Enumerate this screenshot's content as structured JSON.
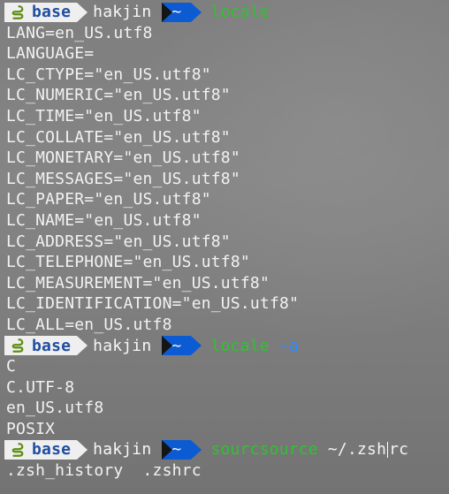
{
  "prompt": {
    "env": "base",
    "user": "hakjin",
    "dir": "~"
  },
  "commands": [
    {
      "command": "locale",
      "arg": "",
      "output": [
        "LANG=en_US.utf8",
        "LANGUAGE=",
        "LC_CTYPE=\"en_US.utf8\"",
        "LC_NUMERIC=\"en_US.utf8\"",
        "LC_TIME=\"en_US.utf8\"",
        "LC_COLLATE=\"en_US.utf8\"",
        "LC_MONETARY=\"en_US.utf8\"",
        "LC_MESSAGES=\"en_US.utf8\"",
        "LC_PAPER=\"en_US.utf8\"",
        "LC_NAME=\"en_US.utf8\"",
        "LC_ADDRESS=\"en_US.utf8\"",
        "LC_TELEPHONE=\"en_US.utf8\"",
        "LC_MEASUREMENT=\"en_US.utf8\"",
        "LC_IDENTIFICATION=\"en_US.utf8\"",
        "LC_ALL=en_US.utf8"
      ]
    },
    {
      "command": "locale",
      "arg": "-a",
      "output": [
        "C",
        "C.UTF-8",
        "en_US.utf8",
        "POSIX"
      ]
    },
    {
      "command_prefix": "sourcsource",
      "path_before_cursor": "~/.zsh",
      "path_after_cursor": "rc",
      "completions": ".zsh_history  .zshrc"
    }
  ],
  "colors": {
    "command_green": "#2ec32e",
    "arg_blue": "#2d8cff",
    "dir_blue": "#0c5bd3",
    "env_bg": "#efefef",
    "env_text": "#204ea0"
  },
  "icons": {
    "env": "python-snake-icon",
    "dir": "tilde-folder-icon"
  }
}
